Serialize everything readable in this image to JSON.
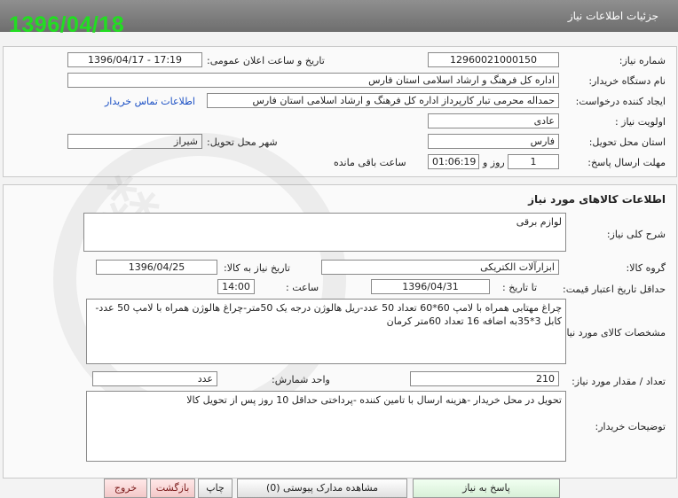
{
  "window": {
    "title": "جزئیات اطلاعات نیاز"
  },
  "stamp": {
    "date": "1396/04/18"
  },
  "need_info": {
    "need_number_label": "شماره نیاز:",
    "need_number": "1296002100015‎0",
    "announce_label": "تاریخ و ساعت اعلان عمومی:",
    "announce_value": "1396/04/17 - 17:19",
    "buyer_label": "نام دستگاه خریدار:",
    "buyer_value": "اداره کل فرهنگ و ارشاد اسلامی استان فارس",
    "creator_label": "ایجاد کننده درخواست:",
    "creator_value": "حمداله محرمی تبار کارپرداز اداره کل فرهنگ و ارشاد اسلامی استان فارس",
    "contact_link": "اطلاعات تماس خریدار",
    "priority_label": "اولویت نیاز :",
    "priority_value": "عادی",
    "province_label": "استان محل تحویل:",
    "province_value": "فارس",
    "city_label": "شهر محل تحویل:",
    "city_value": "شیراز",
    "deadline_label": "مهلت ارسال پاسخ:",
    "deadline_days": "1",
    "days_word": "روز و",
    "deadline_time": "01:06:19",
    "remaining_word": "ساعت باقی مانده"
  },
  "goods": {
    "section_title": "اطلاعات کالاهای مورد نیاز",
    "general_desc_label": "شرح کلی نیاز:",
    "general_desc_value": "لوازم برقی",
    "group_label": "گروه کالا:",
    "group_value": "ابزارآلات الکتریکی",
    "need_date_label": "تاریخ نیاز به کالا:",
    "need_date_value": "1396/04/25",
    "min_price_label": "حداقل تاریخ اعتبار قیمت:",
    "to_date_label": "تا تاریخ :",
    "to_date_value": "1396/04/31",
    "hour_label": "ساعت :",
    "hour_value": "14:00",
    "spec_label": "مشخصات کالای مورد نیاز:",
    "spec_value": "چراغ مهتابی همراه با لامپ 60*60 تعداد 50 عدد-ریل هالوژن درجه یک 50متر-چراغ هالوژن همراه با لامپ 50 عدد-کابل 3*35به اضافه 16 تعداد 60متر کرمان",
    "qty_label": "تعداد / مقدار مورد نیاز:",
    "qty_value": "210",
    "unit_label": "واحد شمارش:",
    "unit_value": "عدد",
    "buyer_desc_label": "توضیحات خریدار:",
    "buyer_desc_value": "تحویل در محل خریدار -هزینه ارسال با تامین کننده -پرداختی حداقل 10 روز پس از تحویل کالا"
  },
  "buttons": {
    "reply": "پاسخ به نیاز",
    "attachments": "مشاهده مدارک پیوستی (0)",
    "print": "چاپ",
    "back": "بازگشت",
    "exit": "خروج"
  }
}
